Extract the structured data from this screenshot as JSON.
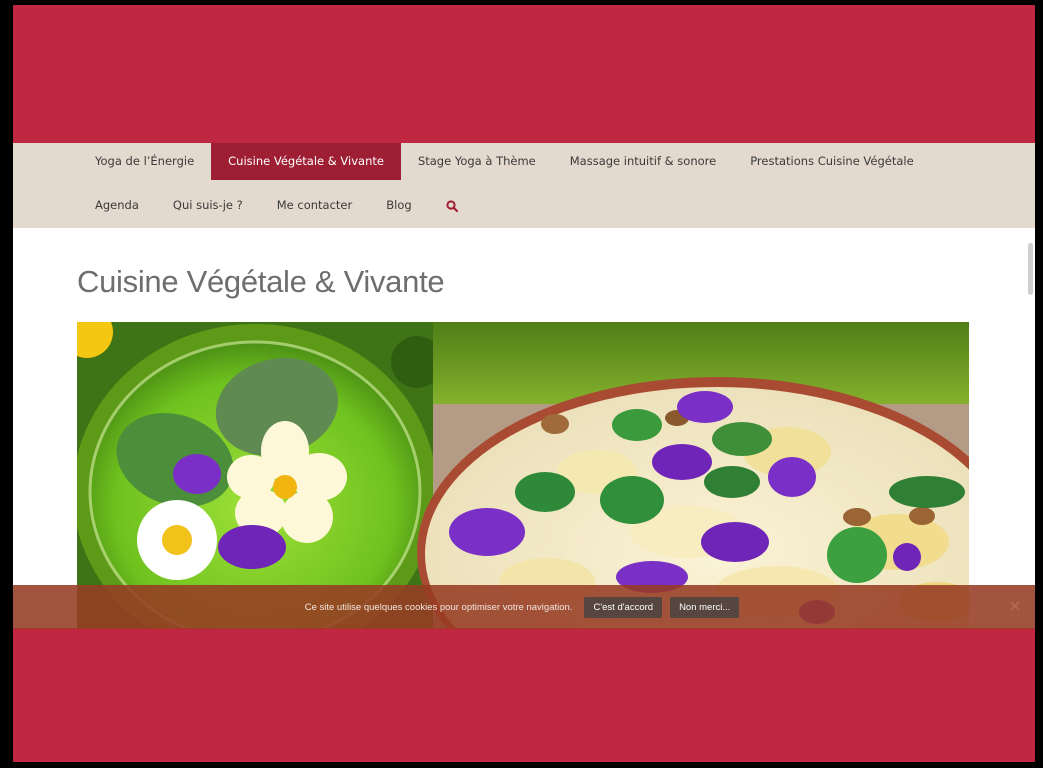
{
  "nav": {
    "row1": [
      {
        "label": "Yoga de l’Énergie",
        "active": false
      },
      {
        "label": "Cuisine Végétale & Vivante",
        "active": true
      },
      {
        "label": "Stage Yoga à Thème",
        "active": false
      },
      {
        "label": "Massage intuitif & sonore",
        "active": false
      },
      {
        "label": "Prestations Cuisine Végétale",
        "active": false
      }
    ],
    "row2": [
      {
        "label": "Agenda"
      },
      {
        "label": "Qui suis-je ?"
      },
      {
        "label": "Me contacter"
      },
      {
        "label": "Blog"
      }
    ],
    "search_icon": "search-icon"
  },
  "page": {
    "title": "Cuisine Végétale & Vivante"
  },
  "cookie": {
    "text": "Ce site utilise quelques cookies pour optimiser votre navigation.",
    "accept_label": "C'est d'accord",
    "decline_label": "Non merci..."
  },
  "colors": {
    "brand": "#c02841",
    "nav_bg": "#e4d9ce",
    "active_nav": "#9e1f33"
  }
}
